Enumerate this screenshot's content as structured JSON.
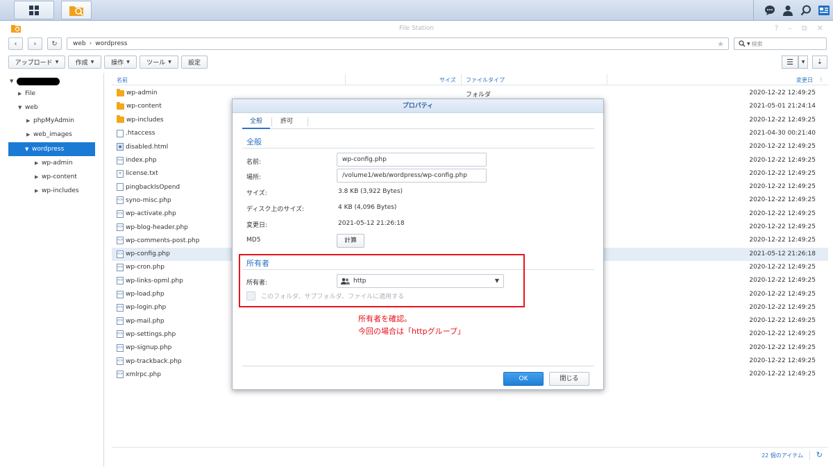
{
  "window": {
    "title": "File Station"
  },
  "nav": {
    "path": [
      "web",
      "wordpress"
    ],
    "search_placeholder": "検索"
  },
  "toolbar": {
    "upload": "アップロード",
    "create": "作成",
    "action": "操作",
    "tools": "ツール",
    "settings": "設定"
  },
  "tree": {
    "items": [
      {
        "label": "File"
      },
      {
        "label": "web"
      },
      {
        "label": "phpMyAdmin"
      },
      {
        "label": "web_images"
      },
      {
        "label": "wordpress"
      },
      {
        "label": "wp-admin"
      },
      {
        "label": "wp-content"
      },
      {
        "label": "wp-includes"
      }
    ]
  },
  "list": {
    "headers": {
      "name": "名前",
      "size": "サイズ",
      "type": "ファイルタイプ",
      "modified": "変更日"
    },
    "rows": [
      {
        "name": "wp-admin",
        "icon": "folder",
        "type": "フォルダ",
        "date": "2020-12-22 12:49:25"
      },
      {
        "name": "wp-content",
        "icon": "folder",
        "type": "",
        "date": "2021-05-01 21:24:14"
      },
      {
        "name": "wp-includes",
        "icon": "folder",
        "type": "",
        "date": "2020-12-22 12:49:25"
      },
      {
        "name": ".htaccess",
        "icon": "blank",
        "type": "",
        "date": "2021-04-30 00:21:40"
      },
      {
        "name": "disabled.html",
        "icon": "html",
        "type": "",
        "date": "2020-12-22 12:49:25"
      },
      {
        "name": "index.php",
        "icon": "code",
        "type": "",
        "date": "2020-12-22 12:49:25"
      },
      {
        "name": "license.txt",
        "icon": "text",
        "type": "",
        "date": "2020-12-22 12:49:25"
      },
      {
        "name": "pingbackIsOpend",
        "icon": "blank",
        "type": "",
        "date": "2020-12-22 12:49:25"
      },
      {
        "name": "syno-misc.php",
        "icon": "code",
        "type": "",
        "date": "2020-12-22 12:49:25"
      },
      {
        "name": "wp-activate.php",
        "icon": "code",
        "type": "",
        "date": "2020-12-22 12:49:25"
      },
      {
        "name": "wp-blog-header.php",
        "icon": "code",
        "type": "",
        "date": "2020-12-22 12:49:25"
      },
      {
        "name": "wp-comments-post.php",
        "icon": "code",
        "type": "",
        "date": "2020-12-22 12:49:25"
      },
      {
        "name": "wp-config.php",
        "icon": "code",
        "type": "",
        "date": "2021-05-12 21:26:18"
      },
      {
        "name": "wp-cron.php",
        "icon": "code",
        "type": "",
        "date": "2020-12-22 12:49:25"
      },
      {
        "name": "wp-links-opml.php",
        "icon": "code",
        "type": "",
        "date": "2020-12-22 12:49:25"
      },
      {
        "name": "wp-load.php",
        "icon": "code",
        "type": "",
        "date": "2020-12-22 12:49:25"
      },
      {
        "name": "wp-login.php",
        "icon": "code",
        "type": "",
        "date": "2020-12-22 12:49:25"
      },
      {
        "name": "wp-mail.php",
        "icon": "code",
        "type": "",
        "date": "2020-12-22 12:49:25"
      },
      {
        "name": "wp-settings.php",
        "icon": "code",
        "type": "",
        "date": "2020-12-22 12:49:25"
      },
      {
        "name": "wp-signup.php",
        "icon": "code",
        "type": "",
        "date": "2020-12-22 12:49:25"
      },
      {
        "name": "wp-trackback.php",
        "icon": "code",
        "type": "",
        "date": "2020-12-22 12:49:25"
      },
      {
        "name": "xmlrpc.php",
        "icon": "code",
        "type": "",
        "date": "2020-12-22 12:49:25"
      }
    ],
    "item_count": "22 個のアイテム"
  },
  "dialog": {
    "title": "プロパティ",
    "tabs": [
      "全般",
      "許可"
    ],
    "general": {
      "section": "全般",
      "name_label": "名前:",
      "name_value": "wp-config.php",
      "location_label": "場所:",
      "location_value": "/volume1/web/wordpress/wp-config.php",
      "size_label": "サイズ:",
      "size_value": "3.8 KB (3,922 Bytes)",
      "disk_size_label": "ディスク上のサイズ:",
      "disk_size_value": "4 KB (4,096 Bytes)",
      "modified_label": "変更日:",
      "modified_value": "2021-05-12 21:26:18",
      "md5_label": "MD5",
      "md5_button": "計算"
    },
    "owner": {
      "section": "所有者",
      "label": "所有者:",
      "value": "http",
      "apply_label": "このフォルダ、サブフォルダ、ファイルに適用する"
    },
    "ok": "OK",
    "close": "閉じる"
  },
  "annotation": {
    "line1": "所有者を確認。",
    "line2": "今回の場合は「httpグループ」"
  },
  "colors": {
    "accent": "#2a73c4",
    "selected": "#1a7ad4",
    "annotation": "#e8121b",
    "folder": "#f3a81a"
  }
}
